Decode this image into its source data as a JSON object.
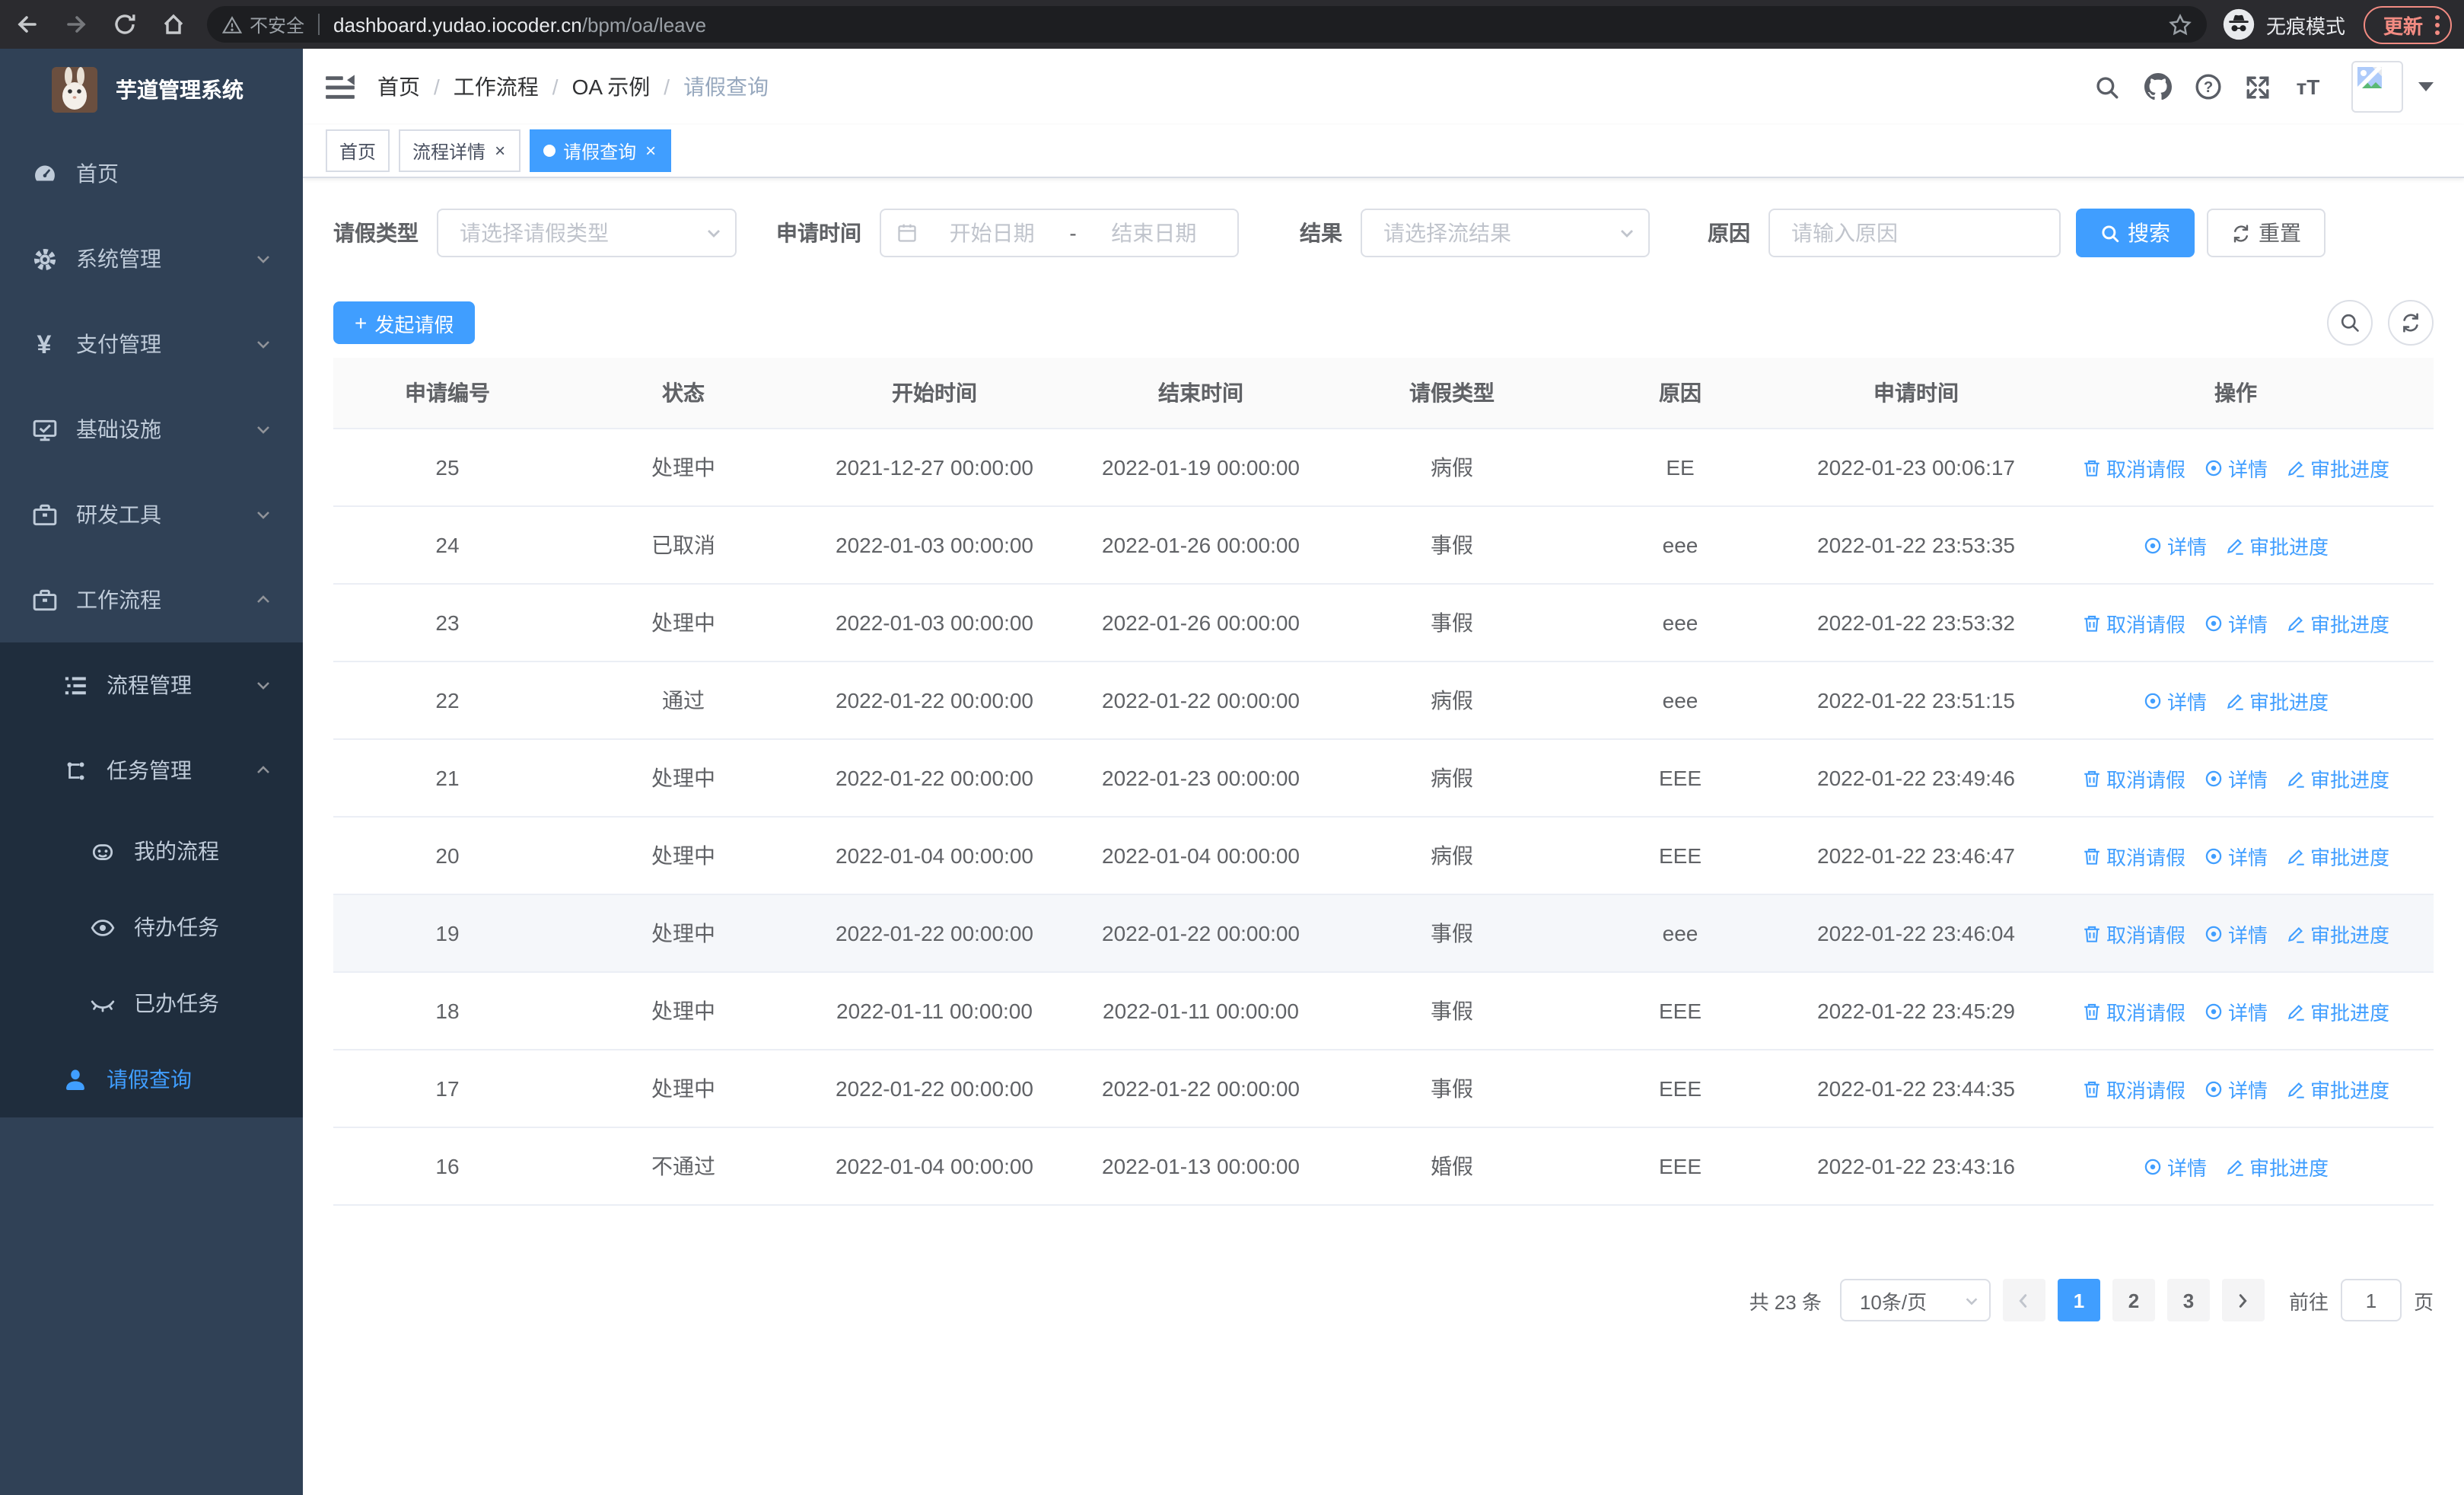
{
  "browser": {
    "security_label": "不安全",
    "url_host": "dashboard.yudao.iocoder.cn",
    "url_path": "/bpm/oa/leave",
    "incognito_label": "无痕模式",
    "update_label": "更新"
  },
  "sidebar": {
    "title": "芋道管理系统",
    "items": [
      {
        "key": "home",
        "label": "首页",
        "icon": "dashboard-icon",
        "level": 1,
        "expand": null,
        "active": false
      },
      {
        "key": "system-mgmt",
        "label": "系统管理",
        "icon": "gear-icon",
        "level": 1,
        "expand": "down",
        "active": false
      },
      {
        "key": "payment-mgmt",
        "label": "支付管理",
        "icon": "yen-icon",
        "level": 1,
        "expand": "down",
        "active": false
      },
      {
        "key": "infrastructure",
        "label": "基础设施",
        "icon": "monitor-icon",
        "level": 1,
        "expand": "down",
        "active": false
      },
      {
        "key": "dev-tools",
        "label": "研发工具",
        "icon": "toolbox-icon",
        "level": 1,
        "expand": "down",
        "active": false
      },
      {
        "key": "workflow",
        "label": "工作流程",
        "icon": "briefcase-icon",
        "level": 1,
        "expand": "up",
        "active": false
      },
      {
        "key": "process-mgmt",
        "label": "流程管理",
        "icon": "list-icon",
        "level": 2,
        "expand": "down",
        "active": false,
        "sub": true
      },
      {
        "key": "task-mgmt",
        "label": "任务管理",
        "icon": "tree-icon",
        "level": 2,
        "expand": "up",
        "active": false,
        "sub": true
      },
      {
        "key": "my-process",
        "label": "我的流程",
        "icon": "robot-icon",
        "level": 3,
        "expand": null,
        "active": false,
        "sub": true
      },
      {
        "key": "todo-tasks",
        "label": "待办任务",
        "icon": "eye-icon",
        "level": 3,
        "expand": null,
        "active": false,
        "sub": true
      },
      {
        "key": "done-tasks",
        "label": "已办任务",
        "icon": "eye-off-icon",
        "level": 3,
        "expand": null,
        "active": false,
        "sub": true
      },
      {
        "key": "leave-query",
        "label": "请假查询",
        "icon": "user-icon",
        "level": 2,
        "expand": null,
        "active": true,
        "sub": true
      }
    ]
  },
  "navbar": {
    "breadcrumb": [
      "首页",
      "工作流程",
      "OA 示例",
      "请假查询"
    ],
    "font_icon_text": "тT"
  },
  "tabs": [
    {
      "label": "首页",
      "active": false,
      "closable": false
    },
    {
      "label": "流程详情",
      "active": false,
      "closable": true
    },
    {
      "label": "请假查询",
      "active": true,
      "closable": true
    }
  ],
  "filters": {
    "leave_type_label": "请假类型",
    "leave_type_placeholder": "请选择请假类型",
    "apply_time_label": "申请时间",
    "start_date_placeholder": "开始日期",
    "date_separator": "-",
    "end_date_placeholder": "结束日期",
    "result_label": "结果",
    "result_placeholder": "请选择流结果",
    "reason_label": "原因",
    "reason_placeholder": "请输入原因",
    "search_label": "搜索",
    "reset_label": "重置"
  },
  "toolbar": {
    "create_label": "发起请假"
  },
  "table": {
    "columns": [
      "申请编号",
      "状态",
      "开始时间",
      "结束时间",
      "请假类型",
      "原因",
      "申请时间",
      "操作"
    ],
    "action_labels": {
      "cancel": "取消请假",
      "detail": "详情",
      "progress": "审批进度"
    },
    "rows": [
      {
        "id": "25",
        "status": "处理中",
        "start": "2021-12-27 00:00:00",
        "end": "2022-01-19 00:00:00",
        "type": "病假",
        "reason": "EE",
        "applied": "2022-01-23 00:06:17",
        "actions": [
          "cancel",
          "detail",
          "progress"
        ],
        "hover": false
      },
      {
        "id": "24",
        "status": "已取消",
        "start": "2022-01-03 00:00:00",
        "end": "2022-01-26 00:00:00",
        "type": "事假",
        "reason": "eee",
        "applied": "2022-01-22 23:53:35",
        "actions": [
          "detail",
          "progress"
        ],
        "hover": false
      },
      {
        "id": "23",
        "status": "处理中",
        "start": "2022-01-03 00:00:00",
        "end": "2022-01-26 00:00:00",
        "type": "事假",
        "reason": "eee",
        "applied": "2022-01-22 23:53:32",
        "actions": [
          "cancel",
          "detail",
          "progress"
        ],
        "hover": false
      },
      {
        "id": "22",
        "status": "通过",
        "start": "2022-01-22 00:00:00",
        "end": "2022-01-22 00:00:00",
        "type": "病假",
        "reason": "eee",
        "applied": "2022-01-22 23:51:15",
        "actions": [
          "detail",
          "progress"
        ],
        "hover": false
      },
      {
        "id": "21",
        "status": "处理中",
        "start": "2022-01-22 00:00:00",
        "end": "2022-01-23 00:00:00",
        "type": "病假",
        "reason": "EEE",
        "applied": "2022-01-22 23:49:46",
        "actions": [
          "cancel",
          "detail",
          "progress"
        ],
        "hover": false
      },
      {
        "id": "20",
        "status": "处理中",
        "start": "2022-01-04 00:00:00",
        "end": "2022-01-04 00:00:00",
        "type": "病假",
        "reason": "EEE",
        "applied": "2022-01-22 23:46:47",
        "actions": [
          "cancel",
          "detail",
          "progress"
        ],
        "hover": false
      },
      {
        "id": "19",
        "status": "处理中",
        "start": "2022-01-22 00:00:00",
        "end": "2022-01-22 00:00:00",
        "type": "事假",
        "reason": "eee",
        "applied": "2022-01-22 23:46:04",
        "actions": [
          "cancel",
          "detail",
          "progress"
        ],
        "hover": true
      },
      {
        "id": "18",
        "status": "处理中",
        "start": "2022-01-11 00:00:00",
        "end": "2022-01-11 00:00:00",
        "type": "事假",
        "reason": "EEE",
        "applied": "2022-01-22 23:45:29",
        "actions": [
          "cancel",
          "detail",
          "progress"
        ],
        "hover": false
      },
      {
        "id": "17",
        "status": "处理中",
        "start": "2022-01-22 00:00:00",
        "end": "2022-01-22 00:00:00",
        "type": "事假",
        "reason": "EEE",
        "applied": "2022-01-22 23:44:35",
        "actions": [
          "cancel",
          "detail",
          "progress"
        ],
        "hover": false
      },
      {
        "id": "16",
        "status": "不通过",
        "start": "2022-01-04 00:00:00",
        "end": "2022-01-13 00:00:00",
        "type": "婚假",
        "reason": "EEE",
        "applied": "2022-01-22 23:43:16",
        "actions": [
          "detail",
          "progress"
        ],
        "hover": false
      }
    ]
  },
  "pagination": {
    "total_label": "共 23 条",
    "page_size": "10条/页",
    "pages": [
      "1",
      "2",
      "3"
    ],
    "active_page": "1",
    "goto_label": "前往",
    "goto_value": "1",
    "page_unit": "页"
  },
  "colors": {
    "accent": "#409eff",
    "sidebar_bg": "#304156",
    "submenu_bg": "#1f2d3d",
    "sidebar_text": "#bfcbd9",
    "update_red": "#f28b82"
  }
}
